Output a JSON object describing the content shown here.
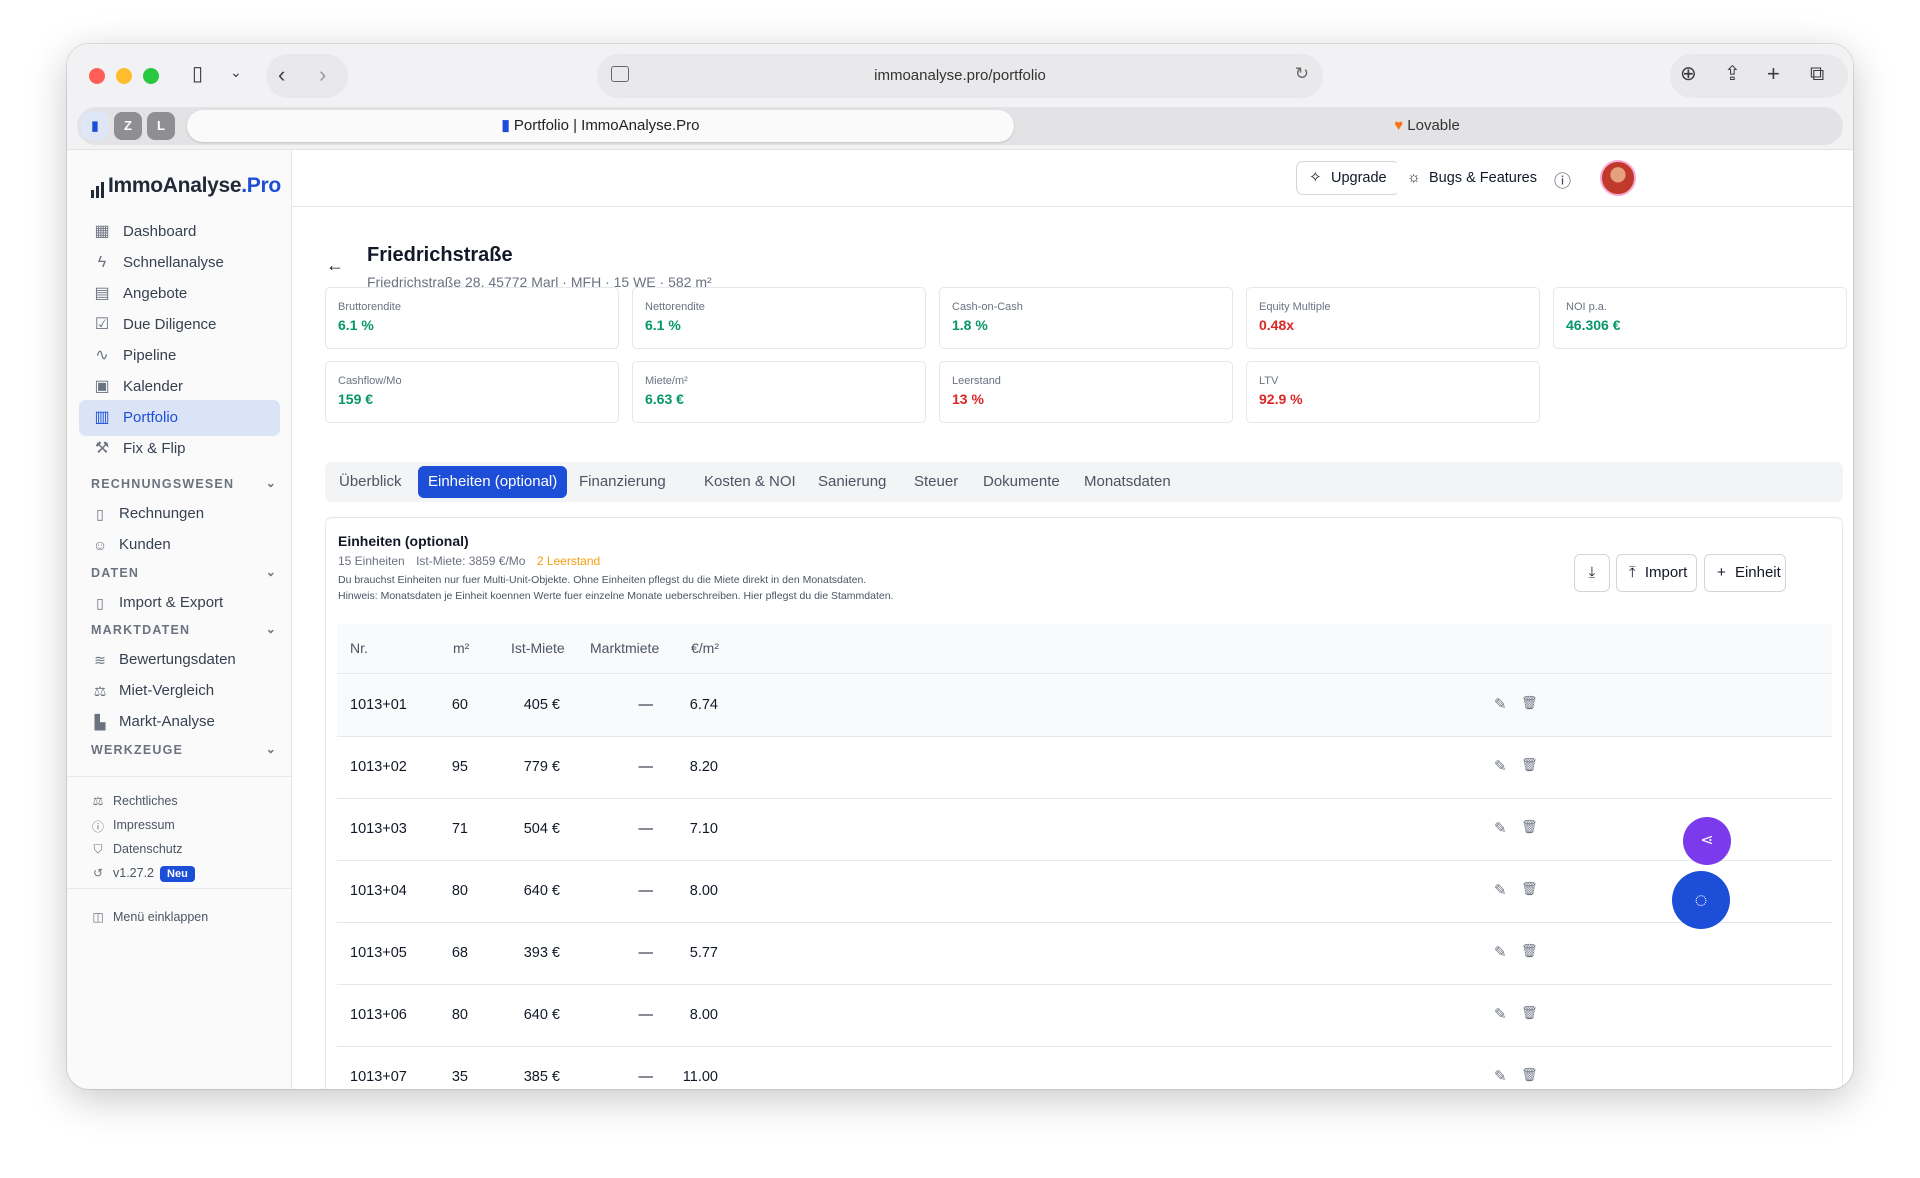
{
  "browser": {
    "url": "immoanalyse.pro/portfolio",
    "pinned_tabs": [
      "Z",
      "L"
    ],
    "tabs": [
      {
        "label": "Portfolio | ImmoAnalyse.Pro"
      },
      {
        "label": "Lovable"
      }
    ]
  },
  "app": {
    "logo_main": "ImmoAnalyse",
    "logo_suffix": ".Pro",
    "accent": "#1d4ed8"
  },
  "sidebar": {
    "items": [
      {
        "label": "Dashboard",
        "icon": "grid-icon"
      },
      {
        "label": "Schnellanalyse",
        "icon": "bolt-icon"
      },
      {
        "label": "Angebote",
        "icon": "building-icon"
      },
      {
        "label": "Due Diligence",
        "icon": "clipboard-icon"
      },
      {
        "label": "Pipeline",
        "icon": "activity-icon"
      },
      {
        "label": "Kalender",
        "icon": "calendar-icon"
      },
      {
        "label": "Portfolio",
        "icon": "portfolio-icon",
        "active": true
      },
      {
        "label": "Fix & Flip",
        "icon": "hammer-icon"
      }
    ],
    "sections": [
      {
        "title": "RECHNUNGSWESEN",
        "items": [
          "Rechnungen",
          "Kunden"
        ]
      },
      {
        "title": "DATEN",
        "items": [
          "Import & Export"
        ]
      },
      {
        "title": "MARKTDATEN",
        "items": [
          "Bewertungsdaten",
          "Miet-Vergleich",
          "Markt-Analyse"
        ]
      },
      {
        "title": "WERKZEUGE",
        "items": []
      }
    ],
    "footer": {
      "legal": "Rechtliches",
      "imprint": "Impressum",
      "privacy": "Datenschutz",
      "version": "v1.27.2",
      "new_badge": "Neu",
      "collapse": "Menü einklappen"
    }
  },
  "topbar": {
    "upgrade": "Upgrade",
    "bugs": "Bugs & Features"
  },
  "property": {
    "title": "Friedrichstraße",
    "subtitle": "Friedrichstraße 28, 45772 Marl · MFH · 15 WE · 582 m²"
  },
  "kpis": [
    {
      "label": "Bruttorendite",
      "value": "6.1 %",
      "color": "#059669"
    },
    {
      "label": "Nettorendite",
      "value": "6.1 %",
      "color": "#059669"
    },
    {
      "label": "Cash-on-Cash",
      "value": "1.8 %",
      "color": "#059669"
    },
    {
      "label": "Equity Multiple",
      "value": "0.48x",
      "color": "#dc2626"
    },
    {
      "label": "NOI p.a.",
      "value": "46.306 €",
      "color": "#059669"
    },
    {
      "label": "Cashflow/Mo",
      "value": "159 €",
      "color": "#059669"
    },
    {
      "label": "Miete/m²",
      "value": "6.63 €",
      "color": "#059669"
    },
    {
      "label": "Leerstand",
      "value": "13 %",
      "color": "#dc2626"
    },
    {
      "label": "LTV",
      "value": "92.9 %",
      "color": "#dc2626"
    }
  ],
  "tabs": [
    "Überblick",
    "Einheiten (optional)",
    "Finanzierung",
    "Kosten & NOI",
    "Sanierung",
    "Steuer",
    "Dokumente",
    "Monatsdaten"
  ],
  "units_card": {
    "title": "Einheiten (optional)",
    "count": "15 Einheiten",
    "rent": "Ist-Miete: 3859 €/Mo",
    "vacancy": "2 Leerstand",
    "hint1": "Du brauchst Einheiten nur fuer Multi-Unit-Objekte. Ohne Einheiten pflegst du die Miete direkt in den Monatsdaten.",
    "hint2": "Hinweis: Monatsdaten je Einheit koennen Werte fuer einzelne Monate ueberschreiben. Hier pflegst du die Stammdaten.",
    "import_label": "Import",
    "add_label": "Einheit",
    "columns": [
      "Nr.",
      "m²",
      "Ist-Miete",
      "Marktmiete",
      "€/m²"
    ],
    "rows": [
      {
        "nr": "1013+01",
        "m2": "60",
        "rent": "405 €",
        "market": "—",
        "per_m2": "6.74"
      },
      {
        "nr": "1013+02",
        "m2": "95",
        "rent": "779 €",
        "market": "—",
        "per_m2": "8.20"
      },
      {
        "nr": "1013+03",
        "m2": "71",
        "rent": "504 €",
        "market": "—",
        "per_m2": "7.10"
      },
      {
        "nr": "1013+04",
        "m2": "80",
        "rent": "640 €",
        "market": "—",
        "per_m2": "8.00"
      },
      {
        "nr": "1013+05",
        "m2": "68",
        "rent": "393 €",
        "market": "—",
        "per_m2": "5.77"
      },
      {
        "nr": "1013+06",
        "m2": "80",
        "rent": "640 €",
        "market": "—",
        "per_m2": "8.00"
      },
      {
        "nr": "1013+07",
        "m2": "35",
        "rent": "385 €",
        "market": "—",
        "per_m2": "11.00"
      }
    ]
  }
}
